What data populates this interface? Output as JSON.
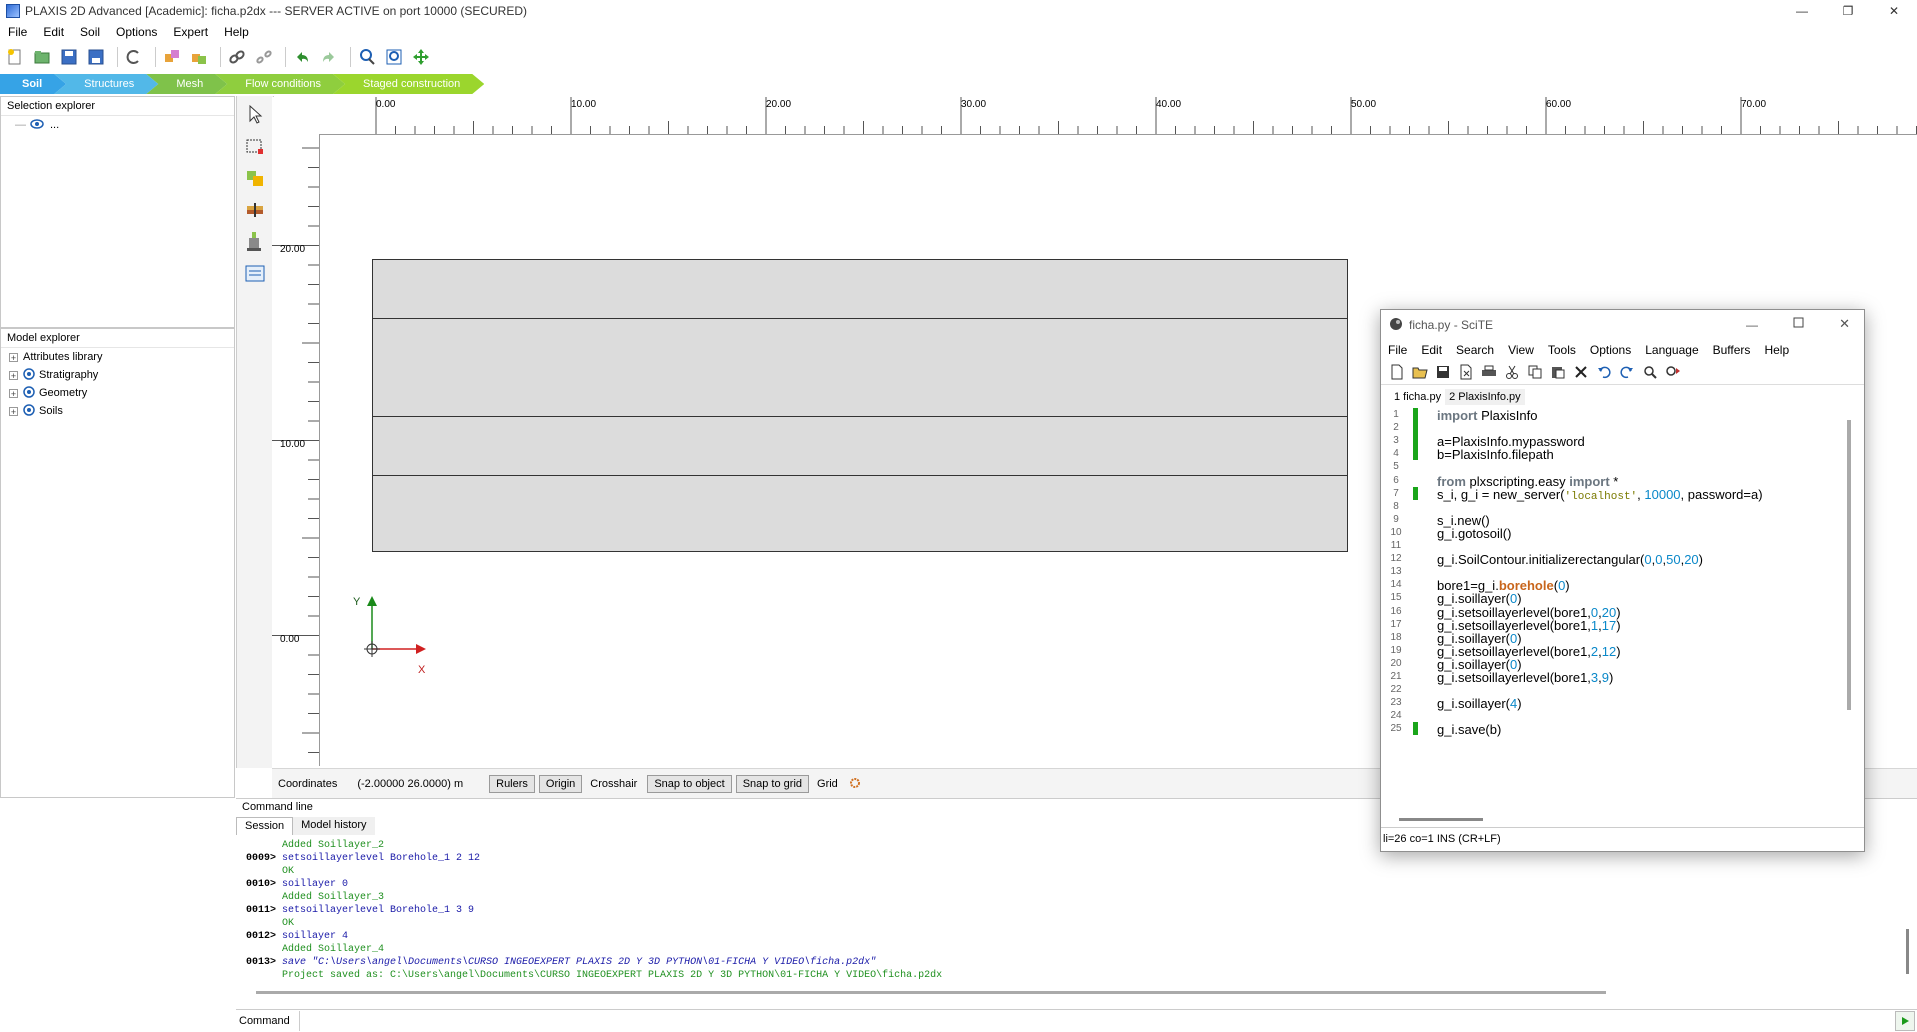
{
  "window": {
    "title": "PLAXIS 2D Advanced [Academic]: ficha.p2dx --- SERVER ACTIVE on port 10000 (SECURED)",
    "controls": [
      "—",
      "❐",
      "✕"
    ]
  },
  "menu": [
    "File",
    "Edit",
    "Soil",
    "Options",
    "Expert",
    "Help"
  ],
  "toolbar": {
    "icons": [
      "new-project-icon",
      "open-project-icon",
      "save-icon",
      "save-as-icon",
      "reset-icon",
      "import-geometry-icon",
      "export-geometry-icon",
      "link-icon",
      "unlink-icon",
      "undo-icon",
      "redo-icon",
      "zoom-icon",
      "zoom-extents-icon",
      "pan-icon"
    ]
  },
  "mode_tabs": [
    {
      "label": "Soil",
      "color": "#36a3e6"
    },
    {
      "label": "Structures",
      "color": "#52b8e8"
    },
    {
      "label": "Mesh",
      "color": "#7fc24a"
    },
    {
      "label": "Flow conditions",
      "color": "#8fce3e"
    },
    {
      "label": "Staged construction",
      "color": "#9bd62d"
    }
  ],
  "selection_explorer": {
    "title": "Selection explorer",
    "item": "..."
  },
  "model_explorer": {
    "title": "Model explorer",
    "items": [
      "Attributes library",
      "Stratigraphy",
      "Geometry",
      "Soils"
    ]
  },
  "ruler": {
    "top_labels": [
      "0.00",
      "10.00",
      "20.00",
      "30.00",
      "40.00",
      "50.00",
      "60.00",
      "70.00"
    ],
    "left_labels": [
      "20.00",
      "10.00",
      "0.00"
    ]
  },
  "axes": {
    "x": "X",
    "y": "Y"
  },
  "statusbar": {
    "coordinates_label": "Coordinates",
    "coordinates_value": "(-2.00000 26.0000) m",
    "rulers": "Rulers",
    "origin": "Origin",
    "crosshair": "Crosshair",
    "snap_object": "Snap to object",
    "snap_grid": "Snap to grid",
    "grid": "Grid"
  },
  "command_line": {
    "title": "Command line",
    "tabs": [
      "Session",
      "Model history"
    ],
    "lines": [
      {
        "num": "",
        "text": "Added Soillayer_2",
        "type": "response"
      },
      {
        "num": "0009>",
        "text": "setsoillayerlevel Borehole_1 2 12",
        "type": "command"
      },
      {
        "num": "",
        "text": "OK",
        "type": "response"
      },
      {
        "num": "0010>",
        "text": "soillayer 0",
        "type": "command"
      },
      {
        "num": "",
        "text": "Added Soillayer_3",
        "type": "response"
      },
      {
        "num": "0011>",
        "text": "setsoillayerlevel Borehole_1 3 9",
        "type": "command"
      },
      {
        "num": "",
        "text": "OK",
        "type": "response"
      },
      {
        "num": "0012>",
        "text": "soillayer 4",
        "type": "command"
      },
      {
        "num": "",
        "text": "Added Soillayer_4",
        "type": "response"
      },
      {
        "num": "0013>",
        "text": "save \"C:\\Users\\angel\\Documents\\CURSO INGEOEXPERT PLAXIS 2D Y 3D PYTHON\\01-FICHA Y VIDEO\\ficha.p2dx\"",
        "type": "save"
      },
      {
        "num": "",
        "text": "Project saved as: C:\\Users\\angel\\Documents\\CURSO INGEOEXPERT PLAXIS 2D Y 3D PYTHON\\01-FICHA Y VIDEO\\ficha.p2dx",
        "type": "response"
      }
    ],
    "input_label": "Command"
  },
  "scite": {
    "title": "ficha.py - SciTE",
    "menu": [
      "File",
      "Edit",
      "Search",
      "View",
      "Tools",
      "Options",
      "Language",
      "Buffers",
      "Help"
    ],
    "tabs": [
      "1 ficha.py",
      "2 PlaxisInfo.py"
    ],
    "status": "li=26 co=1 INS (CR+LF)",
    "line_numbers": [
      "1",
      "2",
      "3",
      "4",
      "5",
      "6",
      "7",
      "8",
      "9",
      "10",
      "11",
      "12",
      "13",
      "14",
      "15",
      "16",
      "17",
      "18",
      "19",
      "20",
      "21",
      "22",
      "23",
      "24",
      "25"
    ],
    "code": [
      "import PlaxisInfo",
      "",
      "a=PlaxisInfo.mypassword",
      "b=PlaxisInfo.filepath",
      "",
      "from plxscripting.easy import *",
      "s_i, g_i = new_server('localhost', 10000, password=a)",
      "",
      "s_i.new()",
      "g_i.gotosoil()",
      "",
      "g_i.SoilContour.initializerectangular(0,0,50,20)",
      "",
      "bore1=g_i.borehole(0)",
      "g_i.soillayer(0)",
      "g_i.setsoillayerlevel(bore1,0,20)",
      "g_i.setsoillayerlevel(bore1,1,17)",
      "g_i.soillayer(0)",
      "g_i.setsoillayerlevel(bore1,2,12)",
      "g_i.soillayer(0)",
      "g_i.setsoillayerlevel(bore1,3,9)",
      "",
      "g_i.soillayer(4)",
      "",
      "g_i.save(b)"
    ]
  }
}
